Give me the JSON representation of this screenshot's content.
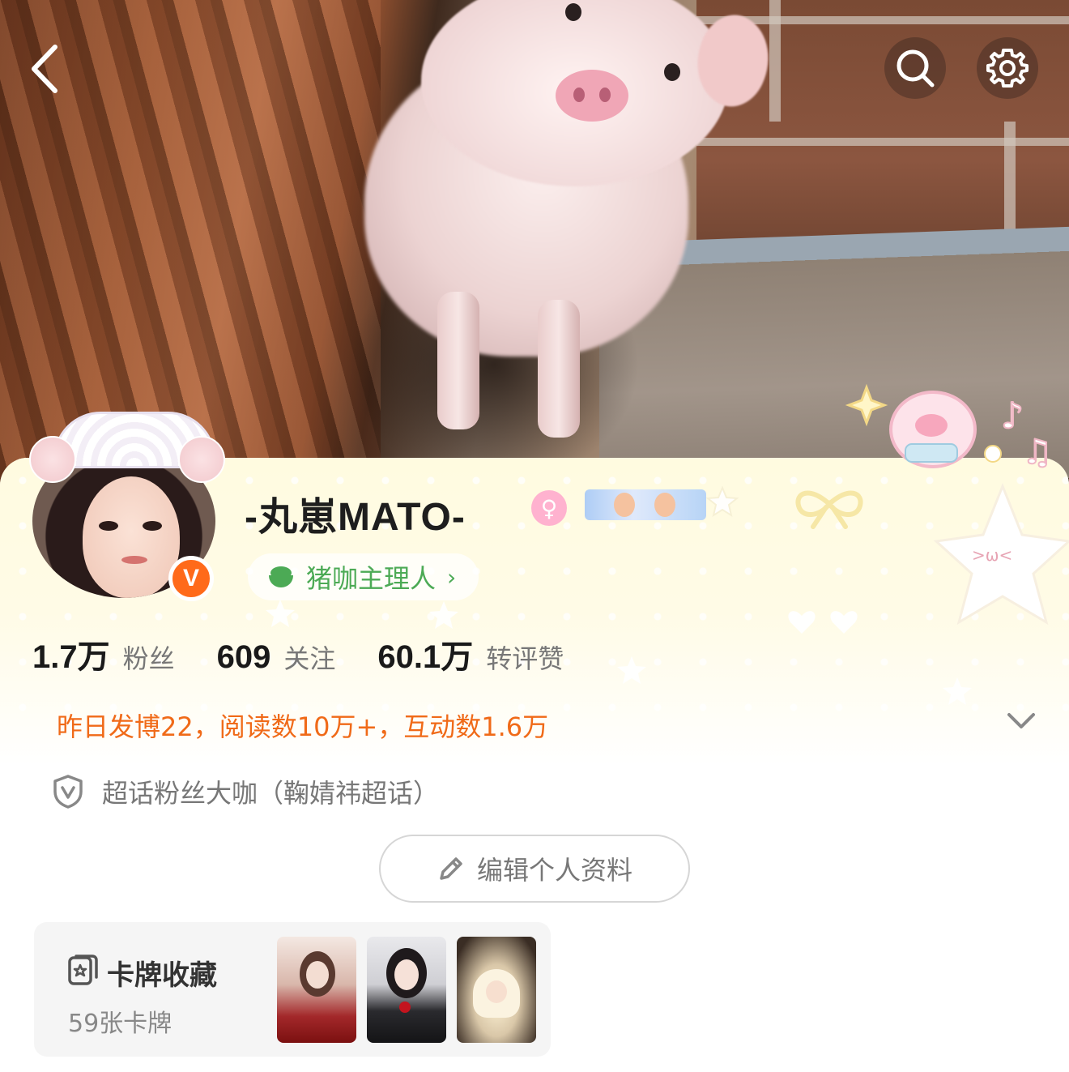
{
  "profile": {
    "name": "-丸崽MATO-",
    "gender_symbol": "♀",
    "verified_badge": "V",
    "tag": "猪咖主理人",
    "tag_chevron": "›"
  },
  "stats": [
    {
      "value": "1.7万",
      "label": "粉丝"
    },
    {
      "value": "609",
      "label": "关注"
    },
    {
      "value": "60.1万",
      "label": "转评赞"
    }
  ],
  "daily_summary": "昨日发博22，阅读数10万+，互动数1.6万",
  "superfan": "超话粉丝大咖（鞠婧祎超话）",
  "edit_profile_label": "编辑个人资料",
  "card_collection": {
    "title": "卡牌收藏",
    "count": "59张卡牌"
  },
  "icons": {
    "back": "chevron-left-icon",
    "search": "search-icon",
    "settings": "gear-icon",
    "expand": "chevron-down-icon",
    "shield": "shield-v-icon",
    "pencil": "pencil-icon",
    "card": "card-star-icon"
  },
  "colors": {
    "accent_orange": "#f06a18",
    "verified_orange": "#ff6a1a",
    "tag_green": "#4caa55",
    "female_pink": "#ffb2cf"
  }
}
